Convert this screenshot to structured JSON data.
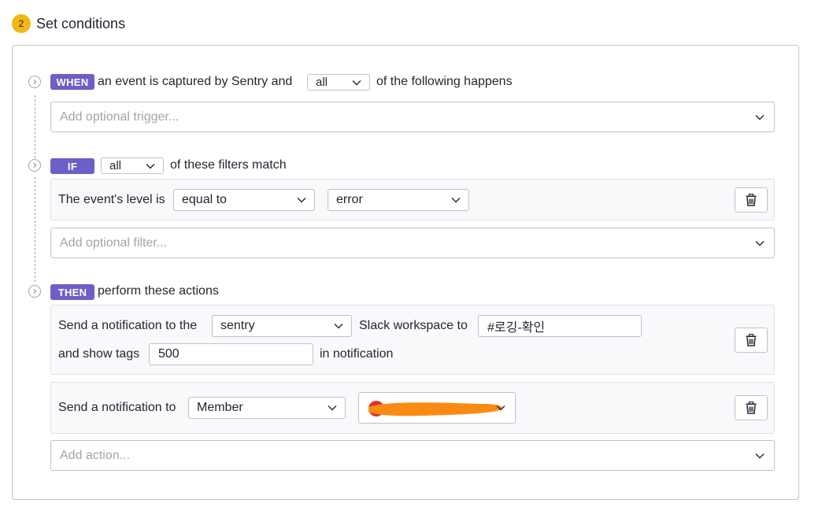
{
  "step": {
    "number": "2",
    "title": "Set conditions"
  },
  "when": {
    "badge": "WHEN",
    "prefix": "an event is captured by Sentry and",
    "match_value": "all",
    "suffix": "of the following happens",
    "trigger_placeholder": "Add optional trigger..."
  },
  "if": {
    "badge": "IF",
    "match_value": "all",
    "suffix": "of these filters match",
    "filter": {
      "label": "The event's level is",
      "operator": "equal to",
      "level": "error"
    },
    "filter_placeholder": "Add optional filter..."
  },
  "then": {
    "badge": "THEN",
    "suffix": "perform these actions",
    "action1": {
      "label_prefix": "Send a notification to the",
      "workspace": "sentry",
      "label_middle": "Slack workspace to",
      "channel": "#로깅-확인",
      "tags_label": "and show tags",
      "tags_value": "500",
      "tags_suffix": "in notification"
    },
    "action2": {
      "label": "Send a notification to",
      "target_type": "Member"
    },
    "action_placeholder": "Add action..."
  },
  "colors": {
    "badge": "#6c5fc7",
    "step_circle": "#f2b712",
    "redaction": "#f98b14"
  }
}
